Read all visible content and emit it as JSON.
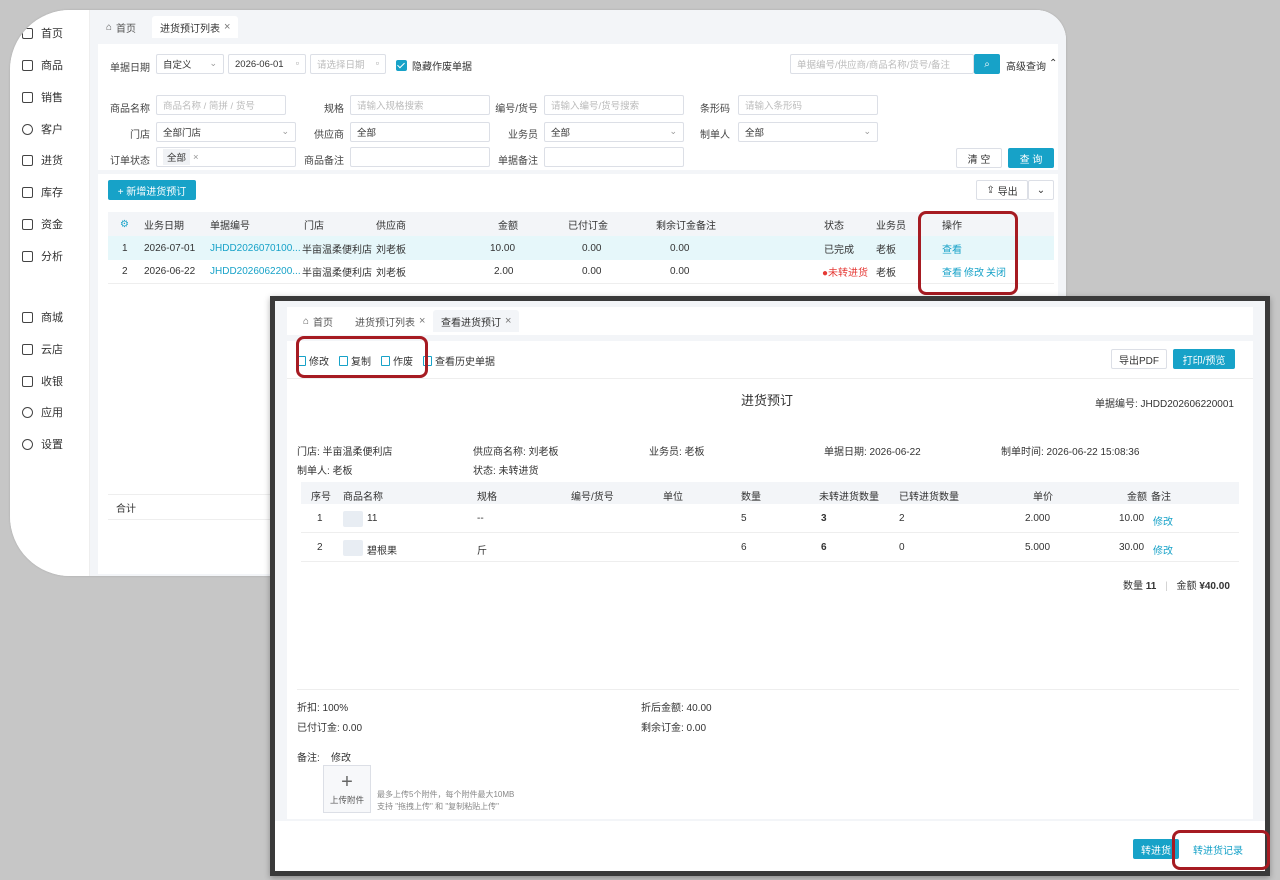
{
  "back": {
    "sidebar": [
      {
        "label": "首页",
        "icon": "home-icon"
      },
      {
        "label": "商品",
        "icon": "goods-icon"
      },
      {
        "label": "销售",
        "icon": "sales-icon"
      },
      {
        "label": "客户",
        "icon": "user-icon"
      },
      {
        "label": "进货",
        "icon": "purchase-icon"
      },
      {
        "label": "库存",
        "icon": "inventory-icon"
      },
      {
        "label": "资金",
        "icon": "funds-icon"
      },
      {
        "label": "分析",
        "icon": "analysis-icon"
      },
      {
        "label": "商城",
        "icon": "mall-icon"
      },
      {
        "label": "云店",
        "icon": "cloudstore-icon"
      },
      {
        "label": "收银",
        "icon": "cashier-icon"
      },
      {
        "label": "应用",
        "icon": "apps-icon"
      },
      {
        "label": "设置",
        "icon": "settings-icon"
      }
    ],
    "tabs": {
      "home": "首页",
      "list": "进货预订列表"
    },
    "filters": {
      "date_label": "单据日期",
      "date_mode": "自定义",
      "start_date": "2026-06-01",
      "end_date_ph": "请选择日期",
      "hide_void": "隐藏作废单据",
      "search_ph": "单据编号/供应商/商品名称/货号/备注",
      "advanced": "高级查询",
      "goods_label": "商品名称",
      "goods_ph": "商品名称 / 简拼 / 货号",
      "spec_label": "规格",
      "spec_ph": "请输入规格搜索",
      "code_label": "编号/货号",
      "code_ph": "请输入编号/货号搜索",
      "barcode_label": "条形码",
      "barcode_ph": "请输入条形码",
      "store_label": "门店",
      "store_val": "全部门店",
      "supplier_label": "供应商",
      "supplier_val": "全部",
      "sales_label": "业务员",
      "sales_val": "全部",
      "maker_label": "制单人",
      "maker_val": "全部",
      "status_label": "订单状态",
      "status_val": "全部",
      "goods_note_label": "商品备注",
      "bill_note_label": "单据备注",
      "clear": "清 空",
      "query": "查 询"
    },
    "toolbar": {
      "add": "+ 新增进货预订",
      "export": "导出"
    },
    "table": {
      "headers": [
        "业务日期",
        "单据编号",
        "门店",
        "供应商",
        "金额",
        "已付订金",
        "剩余订金",
        "备注",
        "状态",
        "业务员",
        "操作"
      ],
      "rows": [
        {
          "no": "1",
          "date": "2026-07-01",
          "code": "JHDD2026070100...",
          "store": "半亩温柔便利店",
          "supplier": "刘老板",
          "amount": "10.00",
          "paid": "0.00",
          "remain": "0.00",
          "status": "已完成",
          "sales": "老板",
          "ops": [
            "查看"
          ]
        },
        {
          "no": "2",
          "date": "2026-06-22",
          "code": "JHDD2026062200...",
          "store": "半亩温柔便利店",
          "supplier": "刘老板",
          "amount": "2.00",
          "paid": "0.00",
          "remain": "0.00",
          "status": "未转进货",
          "sales": "老板",
          "ops": [
            "查看",
            "修改",
            "关闭"
          ]
        }
      ],
      "total_label": "合计"
    }
  },
  "front": {
    "tabs": {
      "home": "首页",
      "list": "进货预订列表",
      "view": "查看进货预订"
    },
    "tools": [
      "修改",
      "复制",
      "作废",
      "查看历史单据"
    ],
    "export_pdf": "导出PDF",
    "print": "打印/预览",
    "title": "进货预订",
    "bill_no": "单据编号: JHDD202606220001",
    "info": {
      "store": "门店: 半亩温柔便利店",
      "supplier": "供应商名称: 刘老板",
      "sales": "业务员: 老板",
      "date": "单据日期: 2026-06-22",
      "made_time": "制单时间: 2026-06-22 15:08:36",
      "maker": "制单人: 老板",
      "status": "状态: 未转进货"
    },
    "table": {
      "headers": [
        "序号",
        "商品名称",
        "规格",
        "编号/货号",
        "单位",
        "数量",
        "未转进货数量",
        "已转进货数量",
        "单价",
        "金额",
        "备注"
      ],
      "rows": [
        {
          "no": "1",
          "name": "11",
          "spec": "--",
          "code": "",
          "unit": "",
          "qty": "5",
          "untrans": "3",
          "trans": "2",
          "price": "2.000",
          "amount": "10.00",
          "note": "修改"
        },
        {
          "no": "2",
          "name": "碧根果",
          "spec": "斤",
          "code": "",
          "unit": "",
          "qty": "6",
          "untrans": "6",
          "trans": "0",
          "price": "5.000",
          "amount": "30.00",
          "note": "修改"
        }
      ]
    },
    "summary": {
      "qty_label": "数量",
      "qty": "11",
      "amount_label": "金额",
      "amount": "¥40.00"
    },
    "discount": "折扣: 100%",
    "after_discount": "折后金额: 40.00",
    "paid_deposit": "已付订金: 0.00",
    "remain_deposit": "剩余订金: 0.00",
    "note_label": "备注:",
    "note_edit": "修改",
    "upload_label": "上传附件",
    "upload_hint1": "最多上传5个附件，每个附件最大10MB",
    "upload_hint2": "支持 \"拖拽上传\" 和 \"复制粘贴上传\"",
    "to_purchase": "转进货",
    "to_purchase_record": "转进货记录"
  },
  "colors": {
    "accent": "#17a2c8",
    "highlight": "#a61b22",
    "status_red": "#e53935"
  }
}
